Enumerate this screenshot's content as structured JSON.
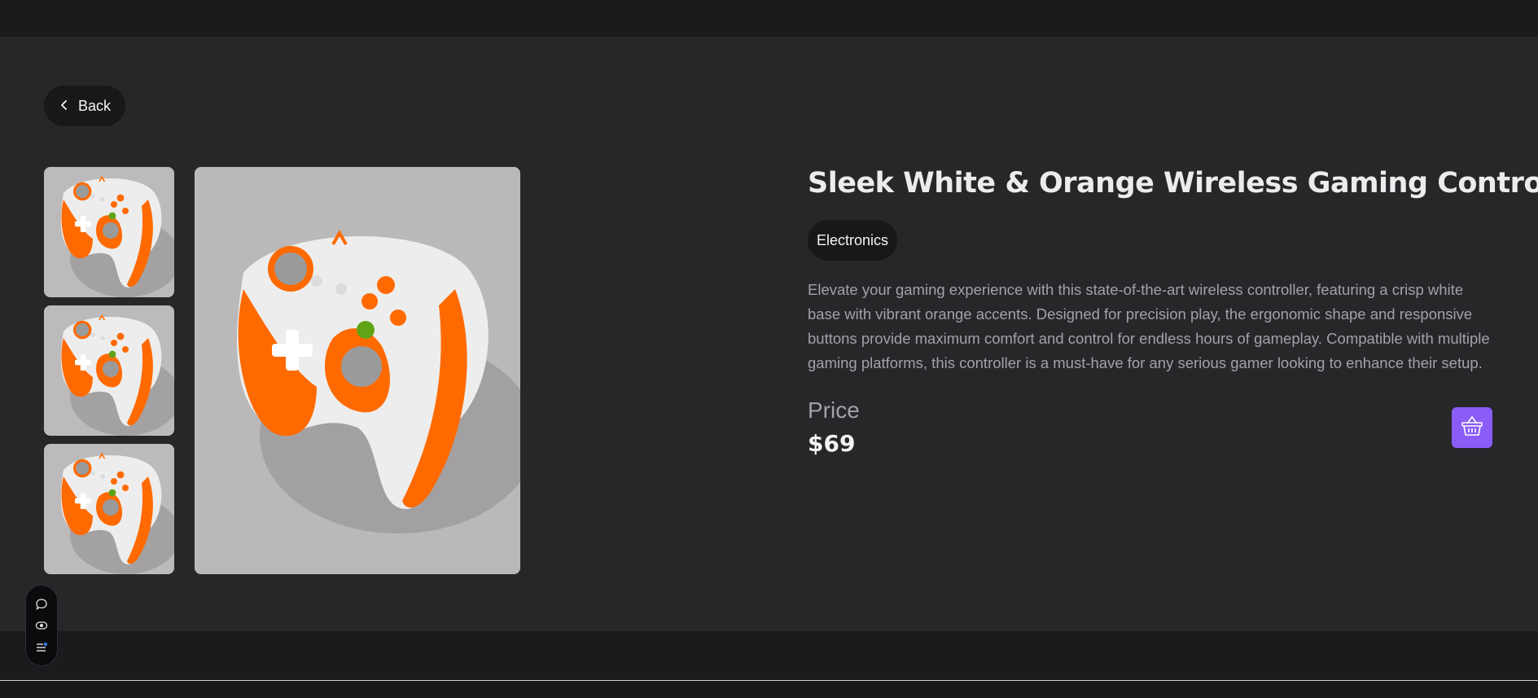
{
  "nav": {
    "back_label": "Back"
  },
  "gallery": {
    "thumbnails": [
      {
        "alt": "controller-thumbnail-1"
      },
      {
        "alt": "controller-thumbnail-2"
      },
      {
        "alt": "controller-thumbnail-3"
      }
    ],
    "main_image": "controller-main-image"
  },
  "product": {
    "title": "Sleek White & Orange Wireless Gaming Controller",
    "category": "Electronics",
    "description": "Elevate your gaming experience with this state-of-the-art wireless controller, featuring a crisp white base with vibrant orange accents. Designed for precision play, the ergonomic shape and responsive buttons provide maximum comfort and control for endless hours of gameplay. Compatible with multiple gaming platforms, this controller is a must-have for any serious gamer looking to enhance their setup.",
    "price_label": "Price",
    "price": "$69"
  },
  "actions": {
    "cart_icon": "basket-icon"
  },
  "toolbar": {
    "icons": [
      "chat-icon",
      "eye-icon",
      "menu-icon"
    ]
  },
  "colors": {
    "accent": "#8b5cf6",
    "background": "#27272a",
    "header": "#1b1b1e",
    "controller_body": "#eeeeee",
    "controller_accent": "#ff6a00"
  }
}
